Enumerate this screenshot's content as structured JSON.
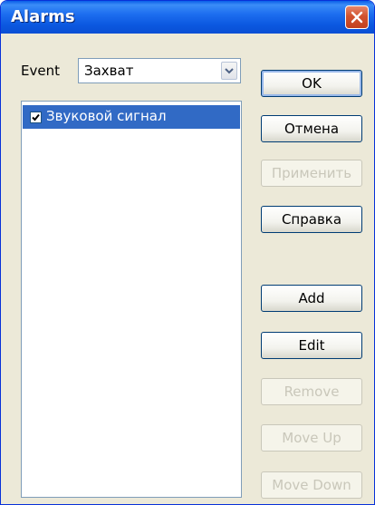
{
  "window": {
    "title": "Alarms"
  },
  "event": {
    "label": "Event",
    "value": "Захват"
  },
  "list": {
    "items": [
      {
        "label": "Звуковой сигнал",
        "checked": true,
        "selected": true
      }
    ]
  },
  "buttons": {
    "ok": "OK",
    "cancel": "Отмена",
    "apply": "Применить",
    "help": "Справка",
    "add": "Add",
    "edit": "Edit",
    "remove": "Remove",
    "move_up": "Move Up",
    "move_down": "Move Down"
  },
  "icons": {
    "close": "close-icon",
    "dropdown": "chevron-down-icon",
    "check": "checkmark-icon"
  },
  "colors": {
    "titlebar": "#0A5FE8",
    "selection": "#316AC5",
    "face": "#ECE9D8",
    "close_button": "#D2532F"
  }
}
